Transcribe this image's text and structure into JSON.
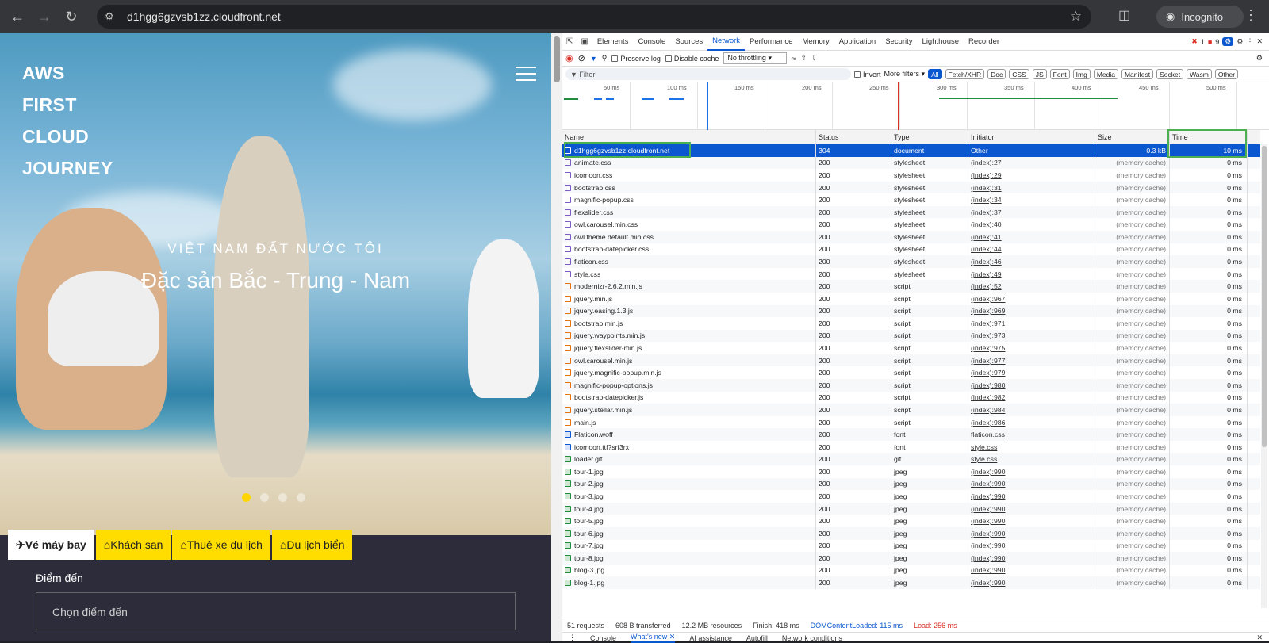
{
  "browser": {
    "url": "d1hgg6gzvsb1zz.cloudfront.net",
    "incognito_label": "Incognito"
  },
  "site": {
    "logo_lines": [
      "AWS",
      "FIRST",
      "CLOUD",
      "JOURNEY"
    ],
    "subtitle": "VIỆT NAM ĐẤT NƯỚC TÔI",
    "headline": "Đặc sản Bắc - Trung - Nam",
    "tabs": [
      "Vé máy bay",
      "Khách san",
      "Thuê xe du lịch",
      "Du lịch biển"
    ],
    "form_label": "Điểm đến",
    "form_placeholder": "Chọn điểm đến"
  },
  "devtools": {
    "tabs": [
      "Elements",
      "Console",
      "Sources",
      "Network",
      "Performance",
      "Memory",
      "Application",
      "Security",
      "Lighthouse",
      "Recorder"
    ],
    "errors": "1",
    "warnings": "9",
    "preserve_log": "Preserve log",
    "disable_cache": "Disable cache",
    "throttle": "No throttling",
    "filter_placeholder": "Filter",
    "invert": "Invert",
    "more_filters": "More filters",
    "type_filters": [
      "All",
      "Fetch/XHR",
      "Doc",
      "CSS",
      "JS",
      "Font",
      "Img",
      "Media",
      "Manifest",
      "Socket",
      "Wasm",
      "Other"
    ],
    "ticks": [
      "50 ms",
      "100 ms",
      "150 ms",
      "200 ms",
      "250 ms",
      "300 ms",
      "350 ms",
      "400 ms",
      "450 ms",
      "500 ms"
    ],
    "columns": [
      "Name",
      "Status",
      "Type",
      "Initiator",
      "Size",
      "Time"
    ],
    "rows": [
      {
        "name": "d1hgg6gzvsb1zz.cloudfront.net",
        "status": "304",
        "type": "document",
        "initiator": "Other",
        "size": "0.3 kB",
        "time": "10 ms",
        "kind": "doc"
      },
      {
        "name": "animate.css",
        "status": "200",
        "type": "stylesheet",
        "initiator": "(index):27",
        "size": "(memory cache)",
        "time": "0 ms",
        "kind": "css"
      },
      {
        "name": "icomoon.css",
        "status": "200",
        "type": "stylesheet",
        "initiator": "(index):29",
        "size": "(memory cache)",
        "time": "0 ms",
        "kind": "css"
      },
      {
        "name": "bootstrap.css",
        "status": "200",
        "type": "stylesheet",
        "initiator": "(index):31",
        "size": "(memory cache)",
        "time": "0 ms",
        "kind": "css"
      },
      {
        "name": "magnific-popup.css",
        "status": "200",
        "type": "stylesheet",
        "initiator": "(index):34",
        "size": "(memory cache)",
        "time": "0 ms",
        "kind": "css"
      },
      {
        "name": "flexslider.css",
        "status": "200",
        "type": "stylesheet",
        "initiator": "(index):37",
        "size": "(memory cache)",
        "time": "0 ms",
        "kind": "css"
      },
      {
        "name": "owl.carousel.min.css",
        "status": "200",
        "type": "stylesheet",
        "initiator": "(index):40",
        "size": "(memory cache)",
        "time": "0 ms",
        "kind": "css"
      },
      {
        "name": "owl.theme.default.min.css",
        "status": "200",
        "type": "stylesheet",
        "initiator": "(index):41",
        "size": "(memory cache)",
        "time": "0 ms",
        "kind": "css"
      },
      {
        "name": "bootstrap-datepicker.css",
        "status": "200",
        "type": "stylesheet",
        "initiator": "(index):44",
        "size": "(memory cache)",
        "time": "0 ms",
        "kind": "css"
      },
      {
        "name": "flaticon.css",
        "status": "200",
        "type": "stylesheet",
        "initiator": "(index):46",
        "size": "(memory cache)",
        "time": "0 ms",
        "kind": "css"
      },
      {
        "name": "style.css",
        "status": "200",
        "type": "stylesheet",
        "initiator": "(index):49",
        "size": "(memory cache)",
        "time": "0 ms",
        "kind": "css"
      },
      {
        "name": "modernizr-2.6.2.min.js",
        "status": "200",
        "type": "script",
        "initiator": "(index):52",
        "size": "(memory cache)",
        "time": "0 ms",
        "kind": "js"
      },
      {
        "name": "jquery.min.js",
        "status": "200",
        "type": "script",
        "initiator": "(index):967",
        "size": "(memory cache)",
        "time": "0 ms",
        "kind": "js"
      },
      {
        "name": "jquery.easing.1.3.js",
        "status": "200",
        "type": "script",
        "initiator": "(index):969",
        "size": "(memory cache)",
        "time": "0 ms",
        "kind": "js"
      },
      {
        "name": "bootstrap.min.js",
        "status": "200",
        "type": "script",
        "initiator": "(index):971",
        "size": "(memory cache)",
        "time": "0 ms",
        "kind": "js"
      },
      {
        "name": "jquery.waypoints.min.js",
        "status": "200",
        "type": "script",
        "initiator": "(index):973",
        "size": "(memory cache)",
        "time": "0 ms",
        "kind": "js"
      },
      {
        "name": "jquery.flexslider-min.js",
        "status": "200",
        "type": "script",
        "initiator": "(index):975",
        "size": "(memory cache)",
        "time": "0 ms",
        "kind": "js"
      },
      {
        "name": "owl.carousel.min.js",
        "status": "200",
        "type": "script",
        "initiator": "(index):977",
        "size": "(memory cache)",
        "time": "0 ms",
        "kind": "js"
      },
      {
        "name": "jquery.magnific-popup.min.js",
        "status": "200",
        "type": "script",
        "initiator": "(index):979",
        "size": "(memory cache)",
        "time": "0 ms",
        "kind": "js"
      },
      {
        "name": "magnific-popup-options.js",
        "status": "200",
        "type": "script",
        "initiator": "(index):980",
        "size": "(memory cache)",
        "time": "0 ms",
        "kind": "js"
      },
      {
        "name": "bootstrap-datepicker.js",
        "status": "200",
        "type": "script",
        "initiator": "(index):982",
        "size": "(memory cache)",
        "time": "0 ms",
        "kind": "js"
      },
      {
        "name": "jquery.stellar.min.js",
        "status": "200",
        "type": "script",
        "initiator": "(index):984",
        "size": "(memory cache)",
        "time": "0 ms",
        "kind": "js"
      },
      {
        "name": "main.js",
        "status": "200",
        "type": "script",
        "initiator": "(index):986",
        "size": "(memory cache)",
        "time": "0 ms",
        "kind": "js"
      },
      {
        "name": "Flaticon.woff",
        "status": "200",
        "type": "font",
        "initiator": "flaticon.css",
        "size": "(memory cache)",
        "time": "0 ms",
        "kind": "font"
      },
      {
        "name": "icomoon.ttf?srf3rx",
        "status": "200",
        "type": "font",
        "initiator": "style.css",
        "size": "(memory cache)",
        "time": "0 ms",
        "kind": "font"
      },
      {
        "name": "loader.gif",
        "status": "200",
        "type": "gif",
        "initiator": "style.css",
        "size": "(memory cache)",
        "time": "0 ms",
        "kind": "img"
      },
      {
        "name": "tour-1.jpg",
        "status": "200",
        "type": "jpeg",
        "initiator": "(index):990",
        "size": "(memory cache)",
        "time": "0 ms",
        "kind": "img"
      },
      {
        "name": "tour-2.jpg",
        "status": "200",
        "type": "jpeg",
        "initiator": "(index):990",
        "size": "(memory cache)",
        "time": "0 ms",
        "kind": "img"
      },
      {
        "name": "tour-3.jpg",
        "status": "200",
        "type": "jpeg",
        "initiator": "(index):990",
        "size": "(memory cache)",
        "time": "0 ms",
        "kind": "img"
      },
      {
        "name": "tour-4.jpg",
        "status": "200",
        "type": "jpeg",
        "initiator": "(index):990",
        "size": "(memory cache)",
        "time": "0 ms",
        "kind": "img"
      },
      {
        "name": "tour-5.jpg",
        "status": "200",
        "type": "jpeg",
        "initiator": "(index):990",
        "size": "(memory cache)",
        "time": "0 ms",
        "kind": "img"
      },
      {
        "name": "tour-6.jpg",
        "status": "200",
        "type": "jpeg",
        "initiator": "(index):990",
        "size": "(memory cache)",
        "time": "0 ms",
        "kind": "img"
      },
      {
        "name": "tour-7.jpg",
        "status": "200",
        "type": "jpeg",
        "initiator": "(index):990",
        "size": "(memory cache)",
        "time": "0 ms",
        "kind": "img"
      },
      {
        "name": "tour-8.jpg",
        "status": "200",
        "type": "jpeg",
        "initiator": "(index):990",
        "size": "(memory cache)",
        "time": "0 ms",
        "kind": "img"
      },
      {
        "name": "blog-3.jpg",
        "status": "200",
        "type": "jpeg",
        "initiator": "(index):990",
        "size": "(memory cache)",
        "time": "0 ms",
        "kind": "img"
      },
      {
        "name": "blog-1.jpg",
        "status": "200",
        "type": "jpeg",
        "initiator": "(index):990",
        "size": "(memory cache)",
        "time": "0 ms",
        "kind": "img"
      }
    ],
    "status_bar": {
      "requests": "51 requests",
      "transferred": "608 B transferred",
      "resources": "12.2 MB resources",
      "finish": "Finish: 418 ms",
      "dcl": "DOMContentLoaded: 115 ms",
      "load": "Load: 256 ms"
    },
    "drawer_tabs": [
      "Console",
      "What's new",
      "AI assistance",
      "Autofill",
      "Network conditions"
    ]
  }
}
